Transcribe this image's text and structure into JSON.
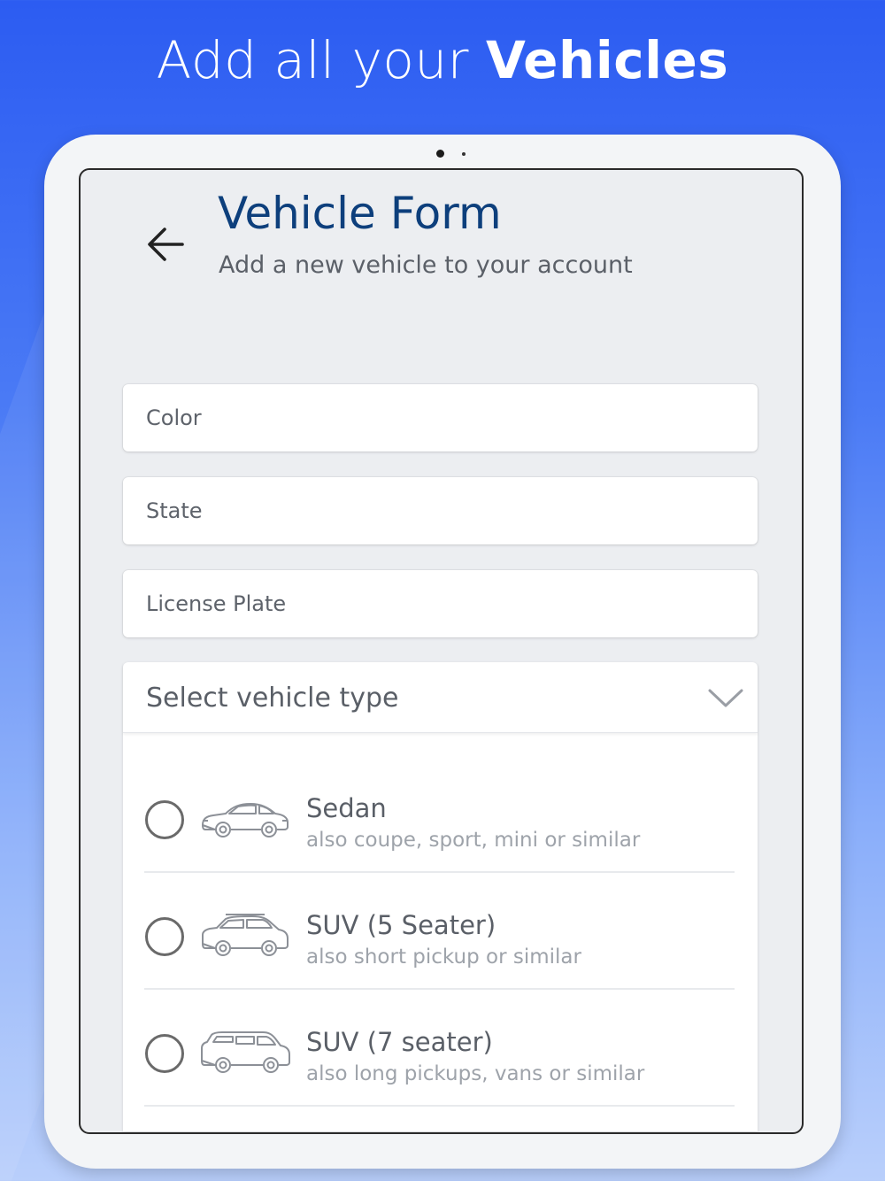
{
  "headline": {
    "light": "Add all your ",
    "bold": "Vehicles"
  },
  "screen": {
    "title": "Vehicle Form",
    "subtitle": "Add a new vehicle to your account"
  },
  "fields": {
    "color_placeholder": "Color",
    "state_placeholder": "State",
    "license_plate_placeholder": "License Plate"
  },
  "vehicle_type": {
    "label": "Select vehicle type",
    "options": [
      {
        "title": "Sedan",
        "description": "also coupe, sport, mini or similar",
        "icon": "sedan-icon",
        "selected": false
      },
      {
        "title": "SUV (5 Seater)",
        "description": "also short pickup or similar",
        "icon": "suv-icon",
        "selected": false
      },
      {
        "title": "SUV (7 seater)",
        "description": "also long pickups, vans or similar",
        "icon": "van-icon",
        "selected": false
      }
    ]
  },
  "colors": {
    "background_top": "#2c5cf2",
    "title": "#0d3f7c"
  }
}
